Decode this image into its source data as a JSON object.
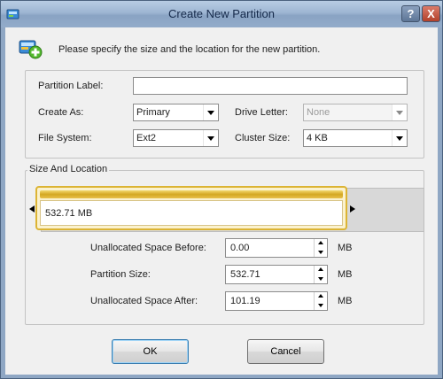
{
  "window": {
    "title": "Create New Partition",
    "help_label": "?",
    "close_label": "X"
  },
  "header": {
    "text": "Please specify the size and the location for the new partition."
  },
  "form": {
    "partition_label": {
      "label": "Partition Label:",
      "value": ""
    },
    "create_as": {
      "label": "Create As:",
      "value": "Primary"
    },
    "drive_letter": {
      "label": "Drive Letter:",
      "value": "None",
      "disabled": true
    },
    "file_system": {
      "label": "File System:",
      "value": "Ext2"
    },
    "cluster_size": {
      "label": "Cluster Size:",
      "value": "4 KB"
    }
  },
  "size_location": {
    "legend": "Size And Location",
    "partition_size_text": "532.71 MB",
    "unallocated_before": {
      "label": "Unallocated Space Before:",
      "value": "0.00",
      "unit": "MB"
    },
    "partition_size": {
      "label": "Partition Size:",
      "value": "532.71",
      "unit": "MB"
    },
    "unallocated_after": {
      "label": "Unallocated Space After:",
      "value": "101.19",
      "unit": "MB"
    }
  },
  "buttons": {
    "ok": "OK",
    "cancel": "Cancel"
  },
  "colors": {
    "titlebar": "#9db5d2",
    "partition_bar": "#d4a722",
    "partition_border": "#dcb434",
    "dialog_background": "#f0f0f0"
  },
  "icons": {
    "app": "partition-wizard-icon",
    "header": "add-partition-icon"
  }
}
